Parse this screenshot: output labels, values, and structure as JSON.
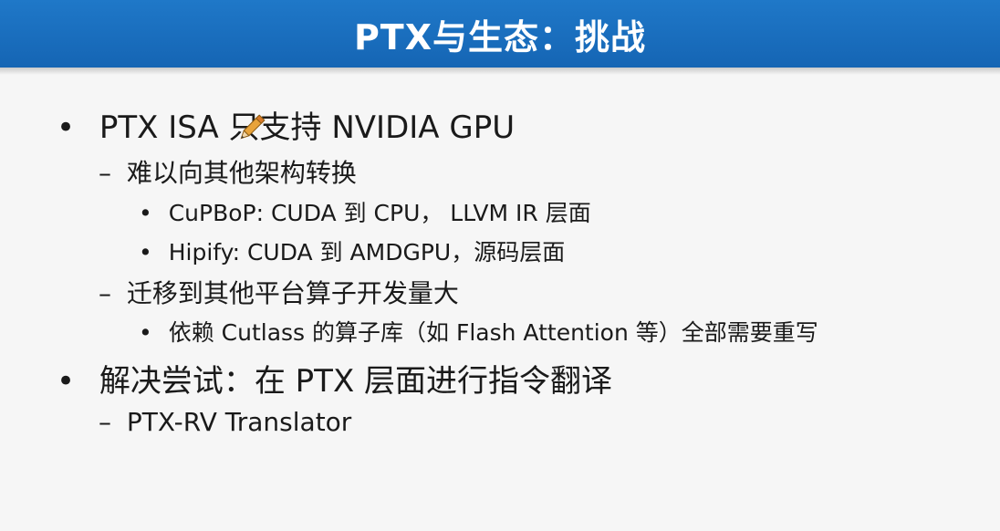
{
  "slide": {
    "title": "PTX与生态：挑战"
  },
  "bullets": {
    "b1": {
      "marker": "•",
      "text": "PTX ISA 只支持 NVIDIA GPU",
      "sub1": {
        "marker": "–",
        "text": "难以向其他架构转换",
        "items": [
          {
            "marker": "•",
            "text": "CuPBoP: CUDA 到 CPU， LLVM IR 层面"
          },
          {
            "marker": "•",
            "text": "Hipify: CUDA 到 AMDGPU，源码层面"
          }
        ]
      },
      "sub2": {
        "marker": "–",
        "text": "迁移到其他平台算子开发量大",
        "items": [
          {
            "marker": "•",
            "text": "依赖 Cutlass 的算子库（如 Flash Attention 等）全部需要重写"
          }
        ]
      }
    },
    "b2": {
      "marker": "•",
      "text": "解决尝试：在 PTX 层面进行指令翻译",
      "sub1": {
        "marker": "–",
        "text": "PTX-RV Translator"
      }
    }
  },
  "cursor": {
    "icon": "pencil-cursor-icon",
    "color": "#e8a33a"
  },
  "colors": {
    "title_bar": "#1a6fc0",
    "background": "#f6f6f6"
  }
}
